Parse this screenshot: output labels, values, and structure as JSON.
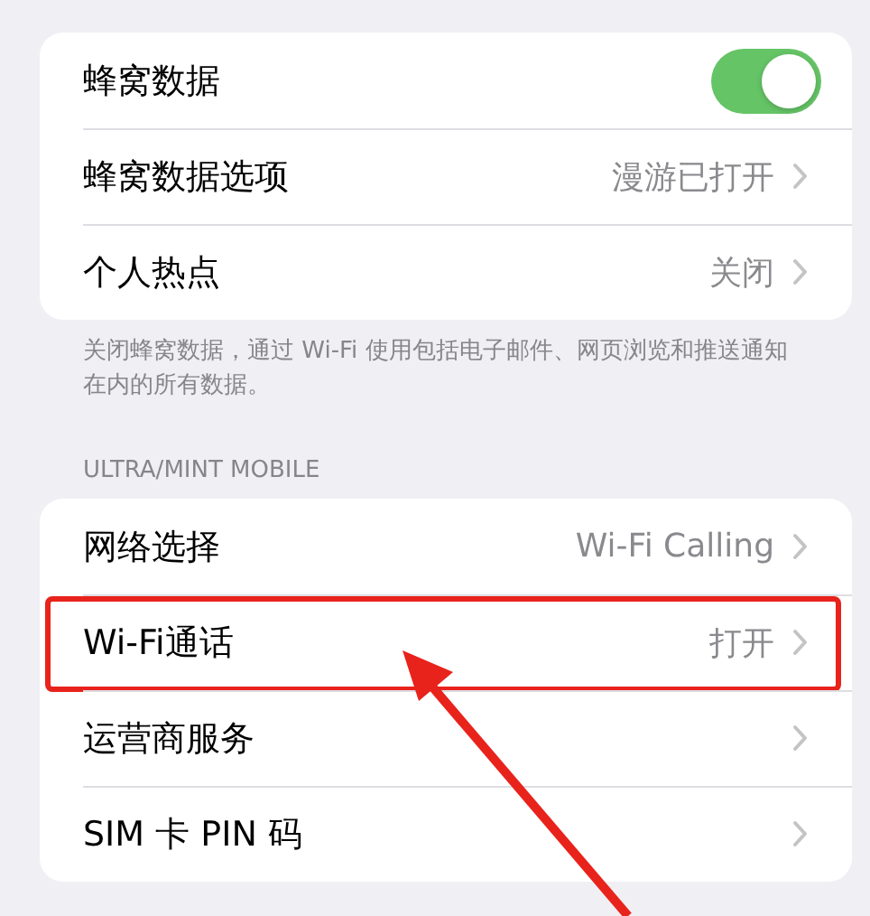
{
  "groups": [
    {
      "rows": [
        {
          "kind": "toggle",
          "label": "蜂窝数据",
          "on": true
        },
        {
          "kind": "link",
          "label": "蜂窝数据选项",
          "value": "漫游已打开"
        },
        {
          "kind": "link",
          "label": "个人热点",
          "value": "关闭"
        }
      ],
      "footer": "关闭蜂窝数据，通过 Wi-Fi 使用包括电子邮件、网页浏览和推送通知在内的所有数据。"
    },
    {
      "header": "ULTRA/MINT MOBILE",
      "rows": [
        {
          "kind": "link",
          "label": "网络选择",
          "value": "Wi-Fi Calling"
        },
        {
          "kind": "link",
          "label": "Wi-Fi通话",
          "value": "打开",
          "highlighted": true
        },
        {
          "kind": "link",
          "label": "运营商服务"
        },
        {
          "kind": "link",
          "label": "SIM 卡 PIN 码"
        }
      ]
    }
  ]
}
